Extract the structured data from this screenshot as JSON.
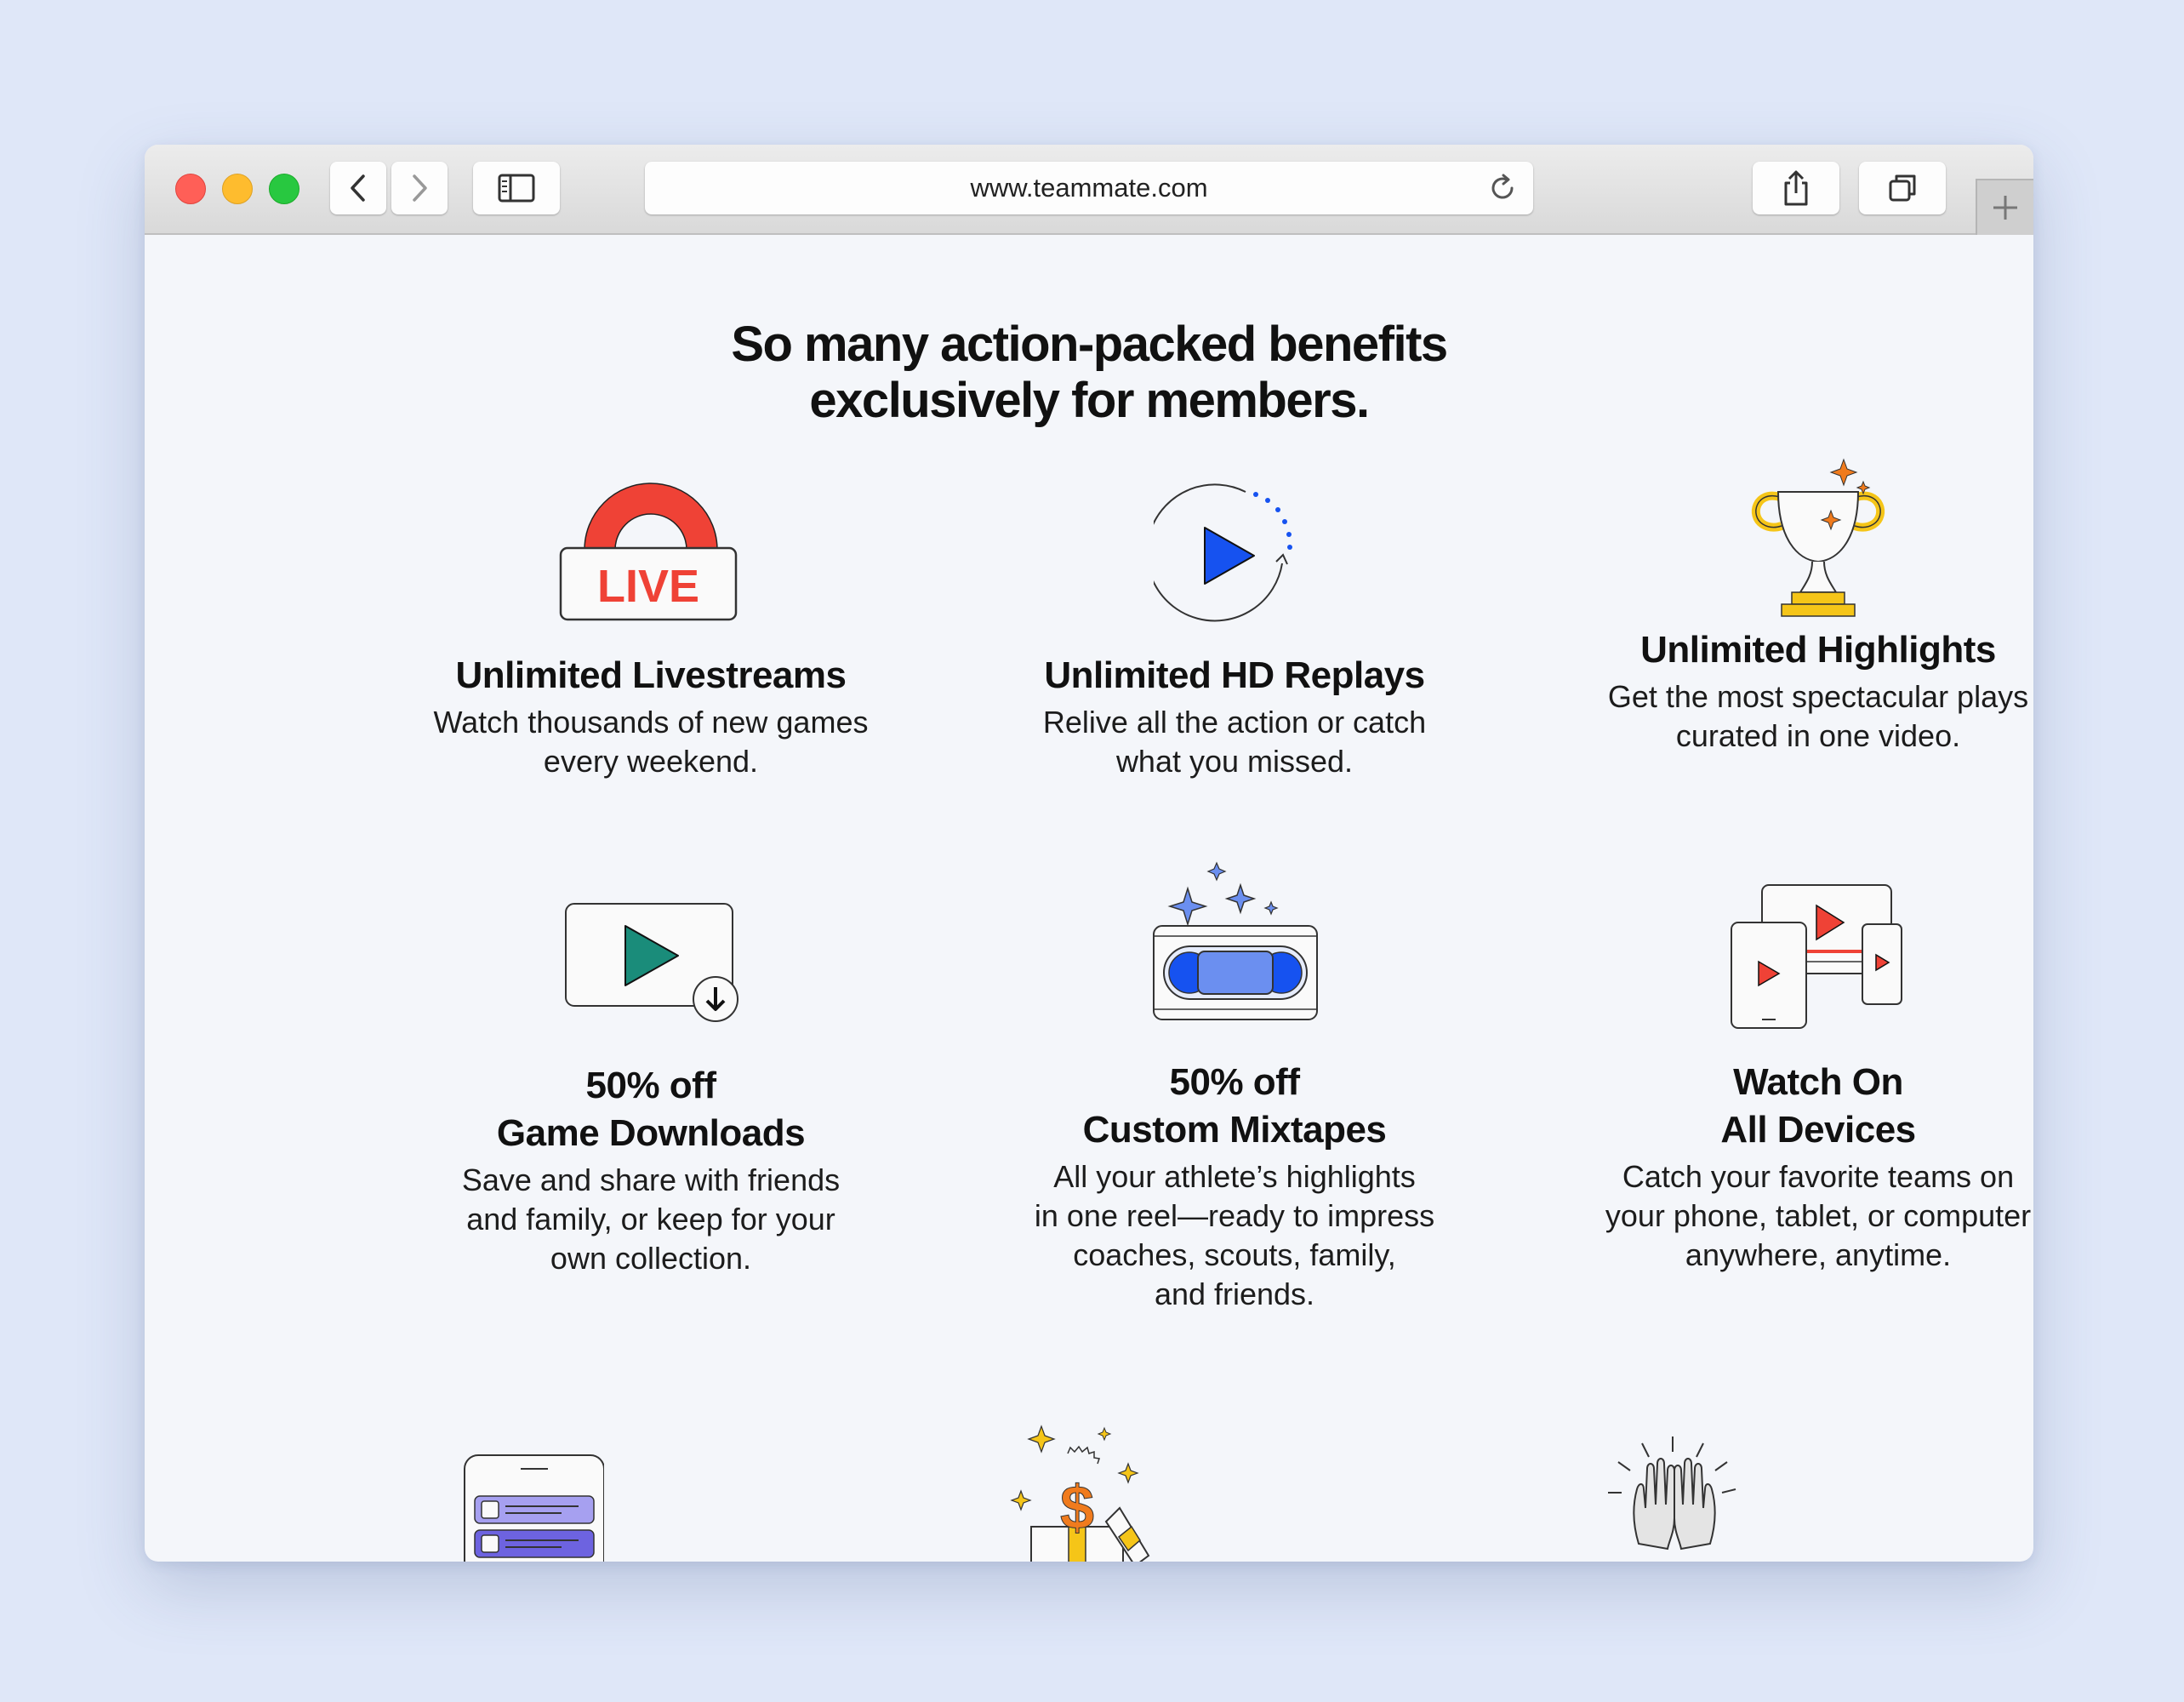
{
  "browser": {
    "url": "www.teammate.com"
  },
  "page": {
    "heading_line1": "So many action-packed benefits",
    "heading_line2": "exclusively for members.",
    "features": [
      {
        "icon": "live-icon",
        "title": [
          "Unlimited Livestreams"
        ],
        "description": [
          "Watch thousands of new games",
          "every weekend."
        ]
      },
      {
        "icon": "replay-play-icon",
        "title": [
          "Unlimited HD Replays"
        ],
        "description": [
          "Relive all the action or catch",
          "what you missed."
        ]
      },
      {
        "icon": "trophy-icon",
        "title": [
          "Unlimited Highlights"
        ],
        "description": [
          "Get the most spectacular plays",
          "curated in one video."
        ]
      },
      {
        "icon": "download-video-icon",
        "title": [
          "50% off",
          "Game Downloads"
        ],
        "description": [
          "Save and share with friends",
          "and family, or keep for your",
          "own collection."
        ]
      },
      {
        "icon": "vhs-tape-icon",
        "title": [
          "50% off",
          "Custom Mixtapes"
        ],
        "description": [
          "All your athlete’s highlights",
          "in one reel—ready to impress",
          "coaches, scouts, family,",
          "and friends."
        ]
      },
      {
        "icon": "devices-icon",
        "title": [
          "Watch On",
          "All Devices"
        ],
        "description": [
          "Catch your favorite teams on",
          "your phone, tablet, or computer",
          "anywhere, anytime."
        ]
      }
    ],
    "partial_icons": [
      "phone-list-icon",
      "dollar-gift-icon",
      "high-five-icon"
    ]
  },
  "colors": {
    "background": "#dfe7f8",
    "page": "#f4f6fa",
    "live_red": "#ef4236",
    "play_blue": "#1652f0",
    "trophy_gold": "#f5c518",
    "sparkle_orange": "#f07b1d",
    "download_teal": "#1a8c7a",
    "tape_blue": "#6b8ff0",
    "list_purple": "#6d63e0"
  }
}
